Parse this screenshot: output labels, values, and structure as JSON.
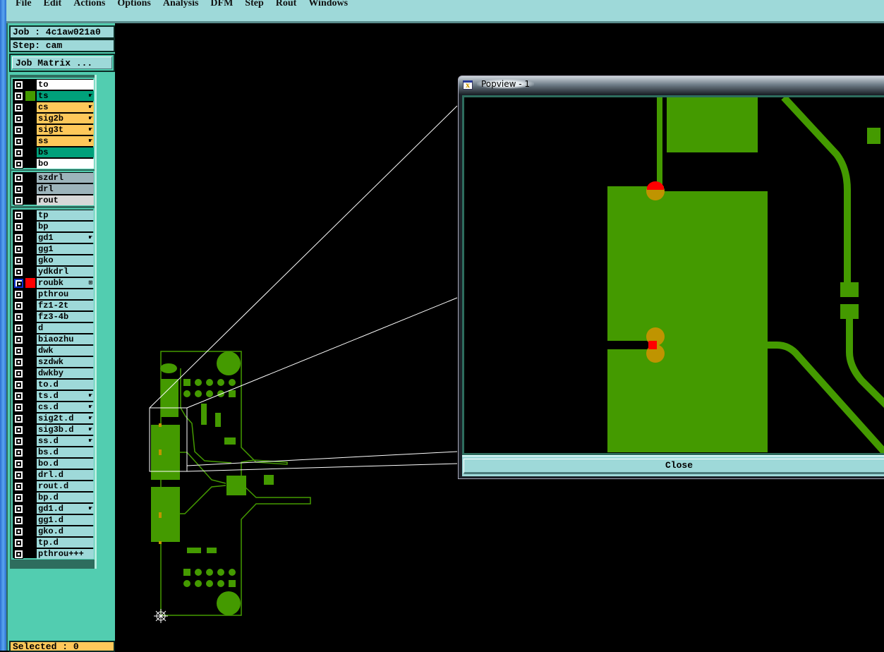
{
  "menubar": {
    "items": [
      "File",
      "Edit",
      "Actions",
      "Options",
      "Analysis",
      "DFM",
      "Step",
      "Rout",
      "Windows"
    ]
  },
  "panel": {
    "job": "Job : 4c1aw021a0",
    "step": "Step: cam",
    "job_matrix": "Job Matrix ...",
    "selected": "Selected : 0"
  },
  "layers": {
    "groups": [
      [
        {
          "name": "to",
          "bg": "#ffffff"
        },
        {
          "name": "ts",
          "bg": "#00a07a",
          "swatch": "#449a00",
          "mark": "hand"
        },
        {
          "name": "cs",
          "bg": "#fec85a",
          "mark": "hand"
        },
        {
          "name": "sig2b",
          "bg": "#fec85a",
          "mark": "hand"
        },
        {
          "name": "sig3t",
          "bg": "#fec85a",
          "mark": "hand"
        },
        {
          "name": "ss",
          "bg": "#fec85a",
          "mark": "hand"
        },
        {
          "name": "bs",
          "bg": "#00a07a"
        },
        {
          "name": "bo",
          "bg": "#ffffff"
        }
      ],
      [
        {
          "name": "szdrl",
          "bg": "#9db4bb"
        },
        {
          "name": "drl",
          "bg": "#9db4bb"
        },
        {
          "name": "rout",
          "bg": "#d8d8d8"
        }
      ],
      [
        {
          "name": "tp"
        },
        {
          "name": "bp"
        },
        {
          "name": "gd1",
          "mark": "hand"
        },
        {
          "name": "gg1"
        },
        {
          "name": "gko"
        },
        {
          "name": "ydkdrl"
        },
        {
          "name": "roubk",
          "swatch": "#ff0000",
          "selected": true,
          "mark": "box"
        },
        {
          "name": "pthrou"
        },
        {
          "name": "fz1-2t"
        },
        {
          "name": "fz3-4b"
        },
        {
          "name": "d"
        },
        {
          "name": "biaozhu"
        },
        {
          "name": "dwk"
        },
        {
          "name": "szdwk"
        },
        {
          "name": "dwkby"
        },
        {
          "name": "to.d"
        },
        {
          "name": "ts.d",
          "mark": "hand"
        },
        {
          "name": "cs.d",
          "mark": "hand"
        },
        {
          "name": "sig2t.d",
          "mark": "hand"
        },
        {
          "name": "sig3b.d",
          "mark": "hand"
        },
        {
          "name": "ss.d",
          "mark": "hand"
        },
        {
          "name": "bs.d"
        },
        {
          "name": "bo.d"
        },
        {
          "name": "drl.d"
        },
        {
          "name": "rout.d"
        },
        {
          "name": "bp.d"
        },
        {
          "name": "gd1.d",
          "mark": "hand"
        },
        {
          "name": "gg1.d"
        },
        {
          "name": "gko.d"
        },
        {
          "name": "tp.d"
        },
        {
          "name": "pthrou+++"
        }
      ]
    ],
    "default_bg": "#9ed9d9"
  },
  "popview": {
    "title": "Popview - 1",
    "close": "Close"
  },
  "colors": {
    "copper": "#449a00",
    "pad": "#bf9400",
    "highlight": "#ff0000",
    "canvas": "#000000"
  }
}
